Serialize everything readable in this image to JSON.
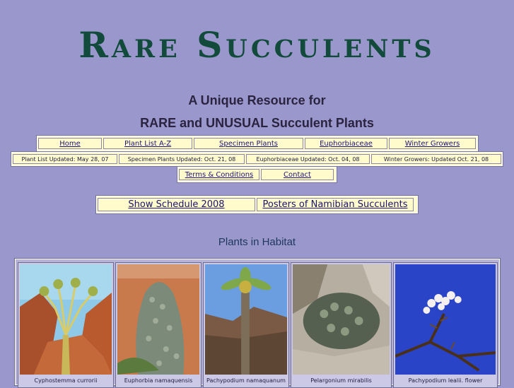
{
  "site": {
    "title": "Rare Succulents",
    "tagline_1": "A Unique Resource for",
    "tagline_2": "RARE and UNUSUAL Succulent Plants"
  },
  "nav_main": [
    "Home",
    "Plant List A-Z",
    "Specimen Plants",
    "Euphorbiaceae",
    "Winter Growers"
  ],
  "updates": [
    "Plant List Updated: May 28, 07",
    "Specimen Plants Updated: Oct. 21, 08",
    "Euphorbiaceae Updated: Oct. 04, 08",
    "Winter Growers: Updated Oct. 21, 08"
  ],
  "nav_secondary": [
    "Terms & Conditions",
    "Contact"
  ],
  "nav_features": [
    "Show Schedule 2008",
    "Posters of Namibian Succulents"
  ],
  "gallery": {
    "title": "Plants in Habitat",
    "items": [
      {
        "caption": "Cyphostemma currorii"
      },
      {
        "caption": "Euphorbia namaquensis"
      },
      {
        "caption": "Pachypodium namaquanum"
      },
      {
        "caption": "Pelargonium mirabilis"
      },
      {
        "caption": "Pachypodium lealii. flower"
      }
    ]
  },
  "colors": {
    "page_bg": "#9a97cc",
    "logo": "#124b3c",
    "nav_bg": "#fffbcc",
    "link": "#1c1470"
  }
}
